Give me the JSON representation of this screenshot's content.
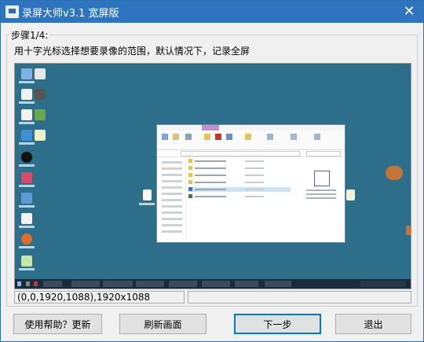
{
  "window": {
    "title": "录屏大师v3.1 宽屏版",
    "close_glyph": "✕"
  },
  "group": {
    "label": "步骤1/4:"
  },
  "instruction": "用十字光标选择想要录像的范围，默认情况下，记录全屏",
  "status": {
    "coords": "(0,0,1920,1088),1920x1088",
    "secondary": ""
  },
  "buttons": {
    "help": "使用帮助？更新",
    "refresh": "刷新画面",
    "next": "下一步",
    "exit": "退出"
  },
  "colors": {
    "titlebar": "#2e74bf",
    "desktop": "#2d6e8b",
    "default_border": "#0078d7"
  }
}
